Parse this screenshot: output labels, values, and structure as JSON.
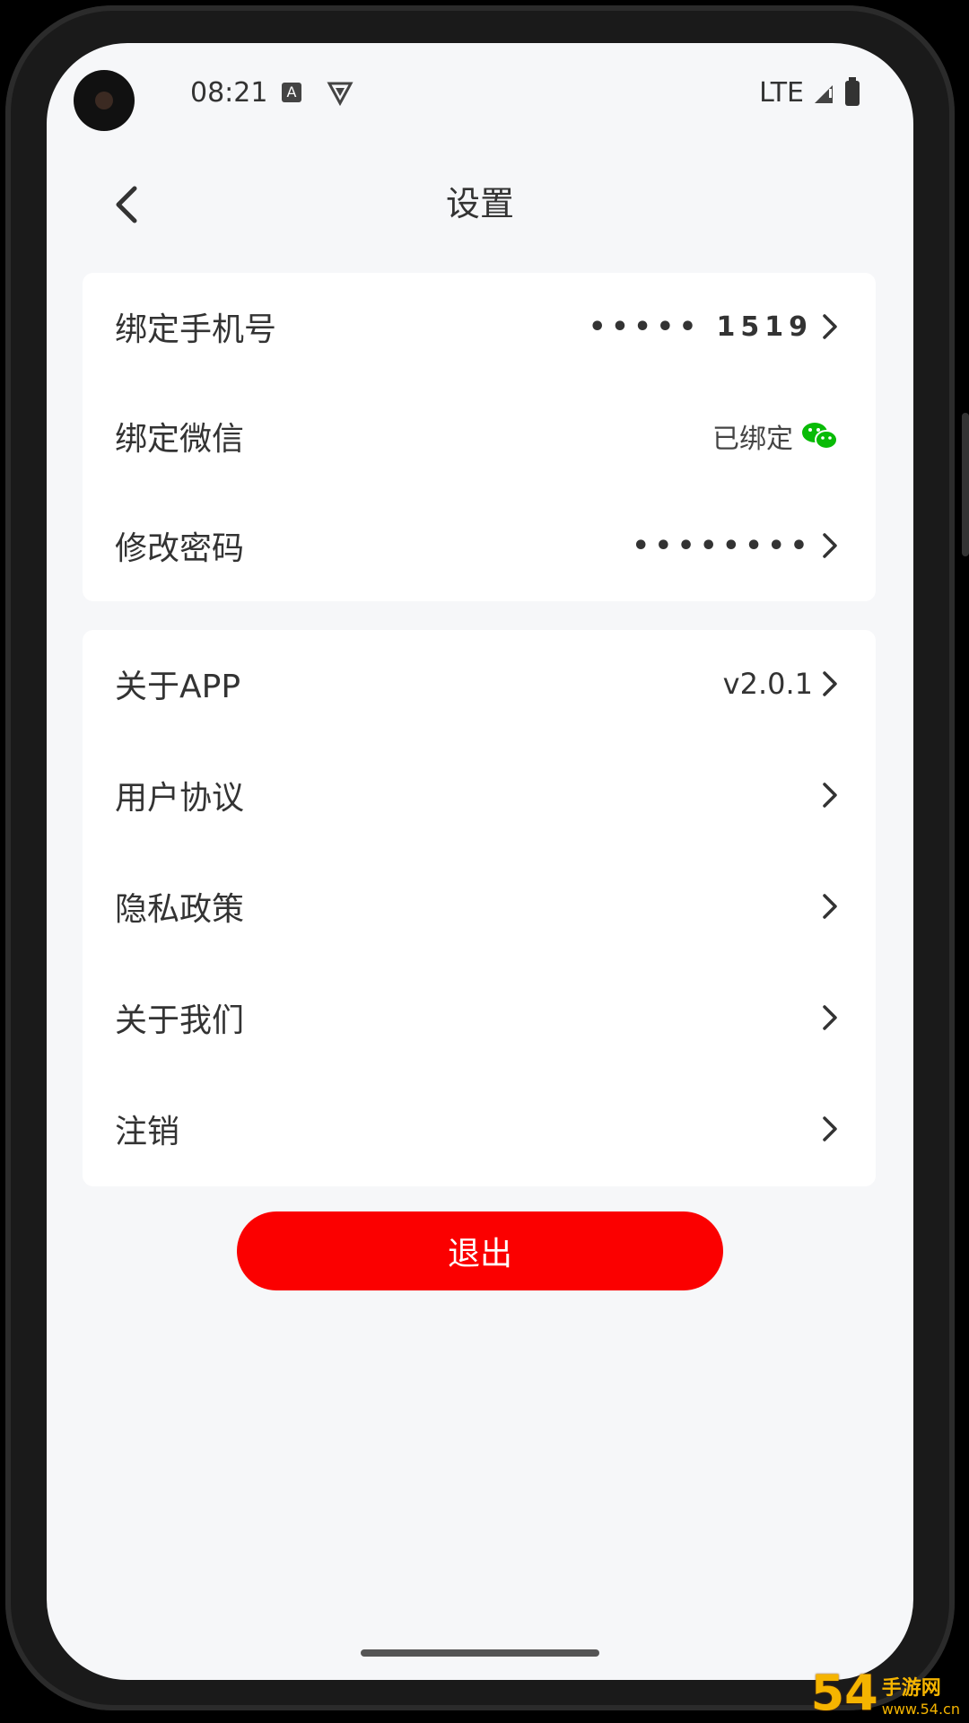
{
  "status_bar": {
    "time": "08:21",
    "network": "LTE",
    "icons": [
      "camera-icon",
      "notification-a-icon",
      "shield-icon",
      "signal-icon",
      "battery-icon"
    ]
  },
  "header": {
    "title": "设置",
    "back_icon": "chevron-left-icon"
  },
  "account_section": {
    "items": [
      {
        "label": "绑定手机号",
        "value": "•••••  1519"
      },
      {
        "label": "绑定微信",
        "value": "已绑定",
        "icon": "wechat-icon"
      },
      {
        "label": "修改密码",
        "value": "••••••••"
      }
    ]
  },
  "about_section": {
    "items": [
      {
        "label": "关于APP",
        "value": "v2.0.1"
      },
      {
        "label": "用户协议"
      },
      {
        "label": "隐私政策"
      },
      {
        "label": "关于我们"
      },
      {
        "label": "注销"
      }
    ]
  },
  "logout": {
    "label": "退出"
  },
  "colors": {
    "accent": "#fb0000",
    "wechat": "#09bb07",
    "background": "#f6f7f9"
  },
  "watermark": {
    "logo": "54",
    "text": "手游网",
    "url": "www.54.cn"
  }
}
